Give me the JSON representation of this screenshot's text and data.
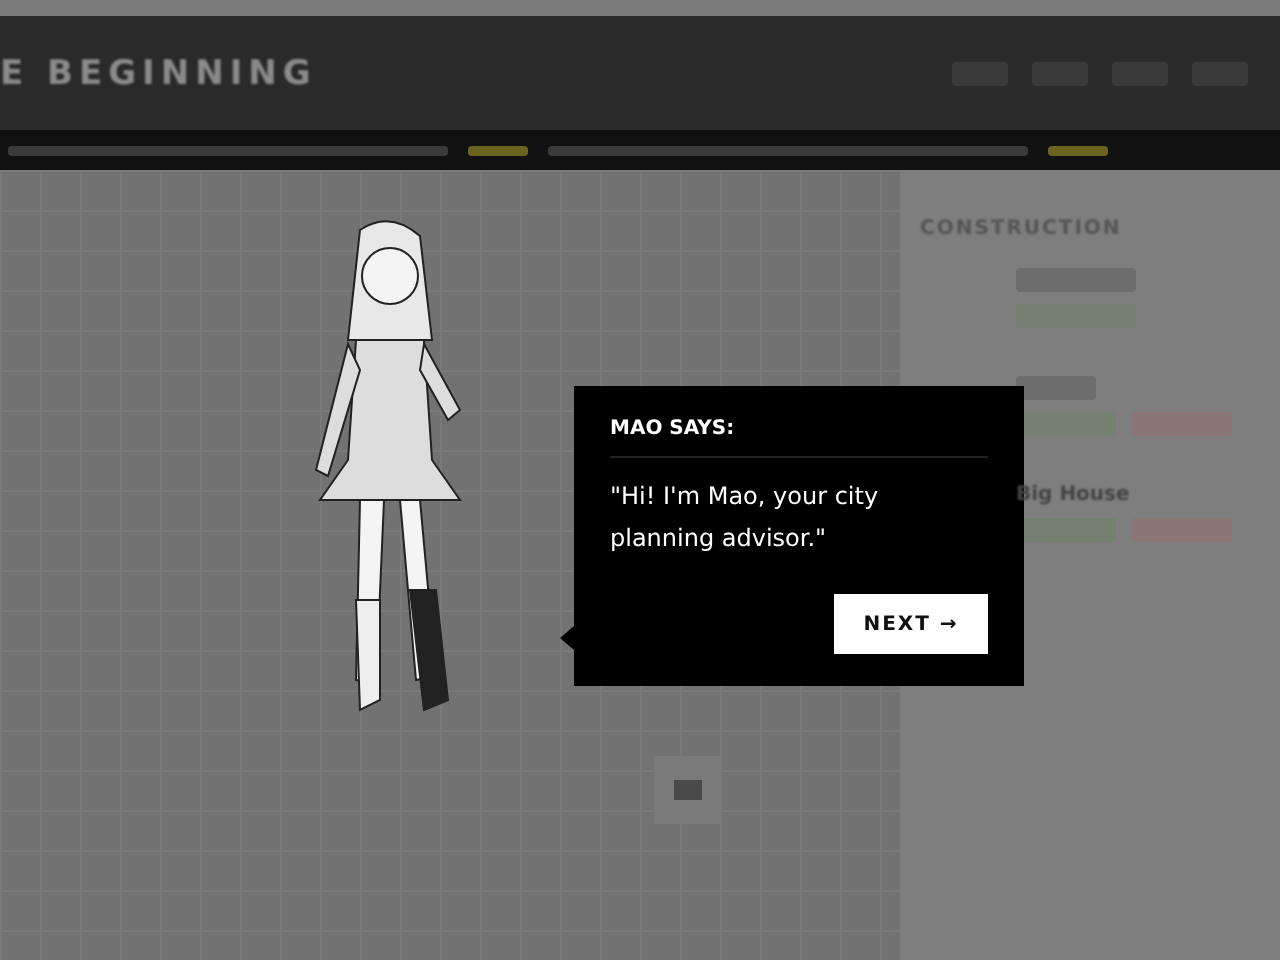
{
  "header": {
    "title": "E BEGINNING"
  },
  "sidebar": {
    "heading": "CONSTRUCTION",
    "items": [
      {
        "name": "Big House"
      }
    ]
  },
  "dialog": {
    "speaker": "MAO SAYS:",
    "message": "\"Hi! I'm Mao, your city planning advisor.\"",
    "button": "NEXT →"
  }
}
